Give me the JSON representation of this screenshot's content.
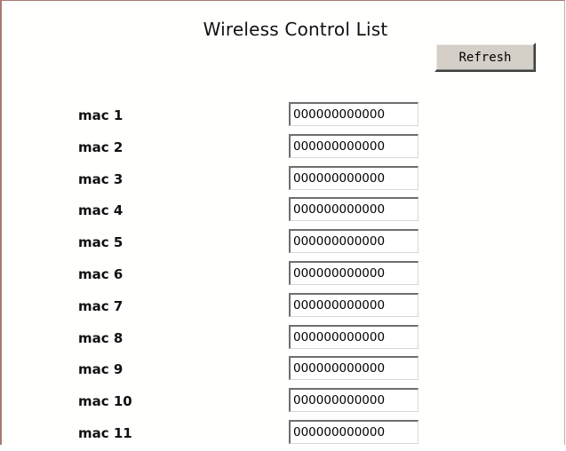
{
  "page": {
    "title": "Wireless Control List",
    "refresh_label": "Refresh"
  },
  "mac_list": [
    {
      "label": "mac 1",
      "value": "000000000000"
    },
    {
      "label": "mac 2",
      "value": "000000000000"
    },
    {
      "label": "mac 3",
      "value": "000000000000"
    },
    {
      "label": "mac 4",
      "value": "000000000000"
    },
    {
      "label": "mac 5",
      "value": "000000000000"
    },
    {
      "label": "mac 6",
      "value": "000000000000"
    },
    {
      "label": "mac 7",
      "value": "000000000000"
    },
    {
      "label": "mac 8",
      "value": "000000000000"
    },
    {
      "label": "mac 9",
      "value": "000000000000"
    },
    {
      "label": "mac 10",
      "value": "000000000000"
    },
    {
      "label": "mac 11",
      "value": "000000000000"
    }
  ],
  "colors": {
    "frame_border": "#a87a72",
    "button_face": "#d4d0c8"
  }
}
